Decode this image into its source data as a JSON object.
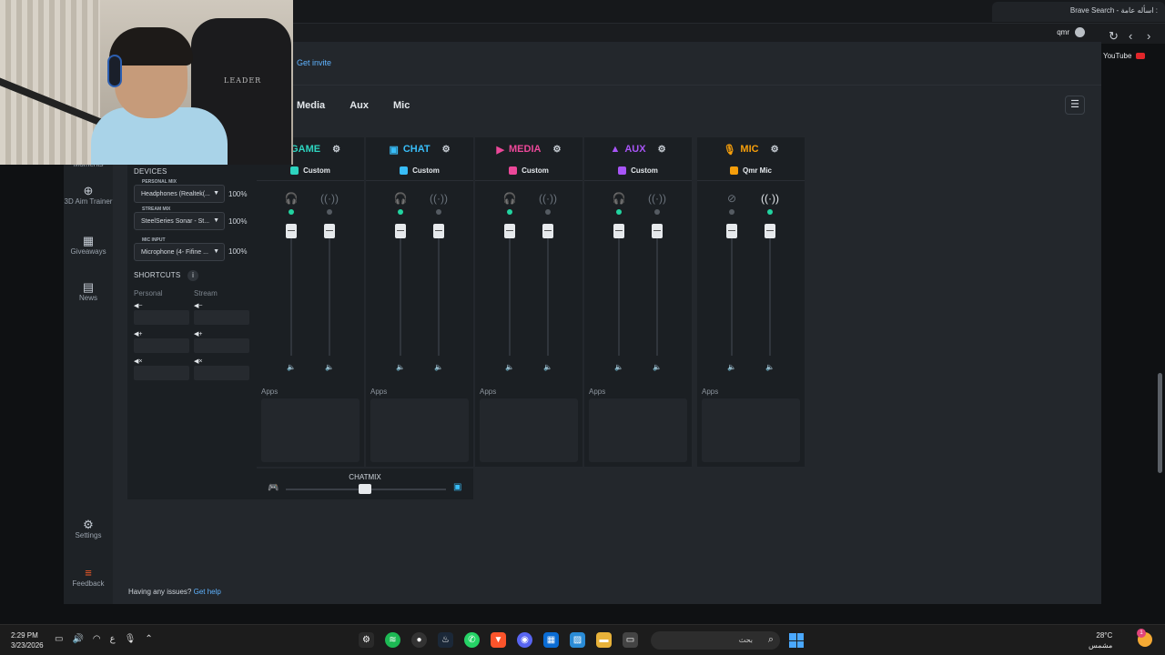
{
  "browser": {
    "tab_title": "Brave Search - اسأله عامة :",
    "profile_name": "qmr",
    "bookmark_youtube": "YouTube"
  },
  "webcam": {
    "chair_brand": "LEADER"
  },
  "header": {
    "get_invite": "Get invite"
  },
  "channel_tabs": [
    "Media",
    "Aux",
    "Mic"
  ],
  "sidebar": {
    "items": [
      {
        "label": "Moments",
        "icon": "moments-icon"
      },
      {
        "label": "3D Aim Trainer",
        "icon": "crosshair-icon"
      },
      {
        "label": "Giveaways",
        "icon": "gift-icon"
      },
      {
        "label": "News",
        "icon": "book-icon"
      },
      {
        "label": "Settings",
        "icon": "gear-icon"
      },
      {
        "label": "Feedback",
        "icon": "feedback-icon"
      }
    ]
  },
  "devices": {
    "title": "DEVICES",
    "personal_mix": {
      "label": "PERSONAL MIX",
      "value": "Headphones (Realtek(...",
      "percent": "100%"
    },
    "stream_mix": {
      "label": "STREAM MIX",
      "value": "SteelSeries Sonar - St...",
      "percent": "100%"
    },
    "mic_input": {
      "label": "MIC INPUT",
      "value": "Microphone (4- Fifine ...",
      "percent": "100%"
    }
  },
  "shortcuts": {
    "title": "SHORTCUTS",
    "personal": "Personal",
    "stream": "Stream"
  },
  "channels": [
    {
      "name": "GAME",
      "color": "#2dd4bf",
      "preset": "Custom",
      "apps": "Apps"
    },
    {
      "name": "CHAT",
      "color": "#38bdf8",
      "preset": "Custom",
      "apps": "Apps"
    },
    {
      "name": "MEDIA",
      "color": "#ec4899",
      "preset": "Custom",
      "apps": "Apps"
    },
    {
      "name": "AUX",
      "color": "#a855f7",
      "preset": "Custom",
      "apps": "Apps"
    },
    {
      "name": "MIC",
      "color": "#f59e0b",
      "preset": "Qmr Mic",
      "apps": "Apps"
    }
  ],
  "chatmix": {
    "label": "CHATMIX",
    "balance": 0.5
  },
  "help": {
    "text": "Having any issues?",
    "link": "Get help"
  },
  "taskbar": {
    "time": "2:29 PM",
    "date": "3/23/2026",
    "search_placeholder": "بحث",
    "temperature": "28°C",
    "weather_text": "مشمس",
    "notification_count": "1",
    "lang": "ع"
  }
}
